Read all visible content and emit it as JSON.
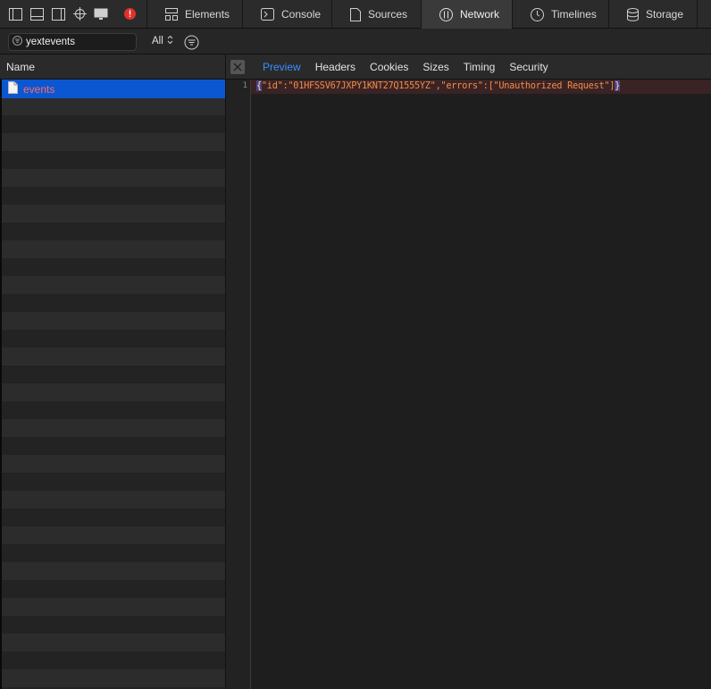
{
  "toolbar": {
    "left_icons": [
      "sidebar-left-icon",
      "dock-bottom-icon",
      "dock-right-icon",
      "inspect-crosshair-icon",
      "device-icon",
      "error-indicator-icon"
    ],
    "tabs": [
      {
        "label": "Elements",
        "icon": "elements-icon",
        "active": false
      },
      {
        "label": "Console",
        "icon": "console-icon",
        "active": false
      },
      {
        "label": "Sources",
        "icon": "sources-icon",
        "active": false
      },
      {
        "label": "Network",
        "icon": "network-icon",
        "active": true
      },
      {
        "label": "Timelines",
        "icon": "timelines-icon",
        "active": false
      },
      {
        "label": "Storage",
        "icon": "storage-icon",
        "active": false
      }
    ]
  },
  "filter": {
    "search_value": "yextevents",
    "type_filter": "All"
  },
  "request_list": {
    "header": "Name",
    "rows": [
      {
        "name": "events",
        "selected": true,
        "status": "error"
      }
    ]
  },
  "detail": {
    "tabs": [
      "Preview",
      "Headers",
      "Cookies",
      "Sizes",
      "Timing",
      "Security"
    ],
    "active_tab": "Preview",
    "line_number": "1",
    "code_open": "{",
    "code_body": "\"id\":\"01HFSSV67JXPY1KNT27Q1555YZ\",\"errors\":[\"Unauthorized Request\"]",
    "code_close": "}"
  },
  "colors": {
    "accent": "#0a57d1",
    "active_tab_text": "#3b8cff",
    "error_text": "#ff6b6b",
    "string_color": "#f08d49"
  }
}
